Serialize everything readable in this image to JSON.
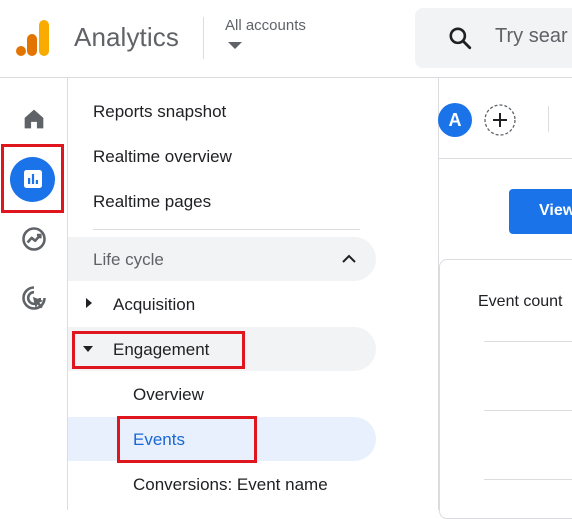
{
  "header": {
    "app_title": "Analytics",
    "account_label": "All accounts",
    "search_placeholder": "Try sear"
  },
  "rail": {
    "items": [
      {
        "icon": "home-icon"
      },
      {
        "icon": "reports-icon",
        "active": true
      },
      {
        "icon": "explore-icon"
      },
      {
        "icon": "advertising-icon"
      }
    ]
  },
  "nav": {
    "items": {
      "reports_snapshot": "Reports snapshot",
      "realtime_overview": "Realtime overview",
      "realtime_pages": "Realtime pages"
    },
    "section": {
      "label": "Life cycle",
      "expanded": true
    },
    "acquisition": "Acquisition",
    "engagement": "Engagement",
    "engagement_children": {
      "overview": "Overview",
      "events": "Events",
      "conversions": "Conversions: Event name"
    }
  },
  "toolbar": {
    "avatar_letter": "A",
    "view_button": "View"
  },
  "card": {
    "title": "Event count"
  },
  "colors": {
    "accent": "#1a73e8",
    "highlight_border": "#e0161e",
    "selected_bg": "#e8f0fe",
    "logo_orange": "#f9ab00",
    "logo_dark_orange": "#e37400"
  }
}
